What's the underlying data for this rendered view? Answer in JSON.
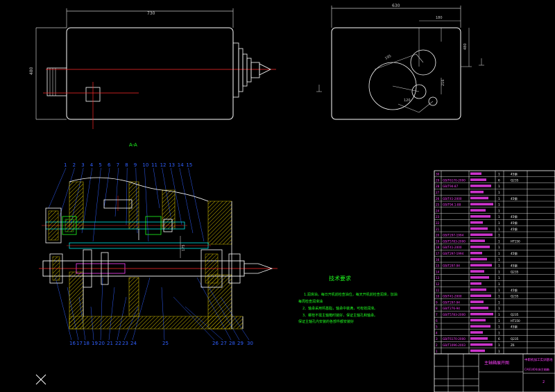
{
  "drawing": {
    "top_view_dim": "730",
    "top_view_height_dim": "480",
    "side_view_dim": "630",
    "side_view_dims": [
      "180",
      "480",
      "195",
      "216",
      "120"
    ],
    "section_label": "A-A",
    "part_numbers_top": [
      "1",
      "2",
      "3",
      "4",
      "5",
      "6",
      "7",
      "8",
      "9",
      "10",
      "11",
      "12",
      "13",
      "14",
      "15"
    ],
    "part_numbers_bottom": [
      "16",
      "17",
      "18",
      "19",
      "20",
      "21",
      "22",
      "23",
      "24",
      "25",
      "26",
      "27",
      "28",
      "29",
      "30"
    ],
    "inner_dims": [
      "175"
    ]
  },
  "tech_requirements": {
    "title": "技术要求",
    "lines": [
      "1.润滑油，每日开机前检查油位，每天开机前检查润滑，加油",
      "每周检查润滑油",
      "2、轴承采用钙基脂，轴承中装满，可有效润滑。",
      "3、螺栓不需主轴箱时装好，保证主轴孔和轴承。",
      "保证主轴孔内安装的各部件都安装好"
    ]
  },
  "bom": {
    "rows": [
      {
        "no": "30",
        "code": "",
        "name": "",
        "qty": "1",
        "mat": "45钢"
      },
      {
        "no": "29",
        "code": "GB/T6170-2000",
        "name": "",
        "qty": "6",
        "mat": "Q235"
      },
      {
        "no": "28",
        "code": "GB/T94-87",
        "name": "",
        "qty": "1",
        "mat": ""
      },
      {
        "no": "27",
        "code": "",
        "name": "",
        "qty": "1",
        "mat": ""
      },
      {
        "no": "26",
        "code": "GB/T41-2000",
        "name": "",
        "qty": "1",
        "mat": "45钢"
      },
      {
        "no": "25",
        "code": "GB/T94.1-88",
        "name": "",
        "qty": "1",
        "mat": ""
      },
      {
        "no": "24",
        "code": "",
        "name": "",
        "qty": "1",
        "mat": ""
      },
      {
        "no": "23",
        "code": "",
        "name": "",
        "qty": "1",
        "mat": "45钢"
      },
      {
        "no": "22",
        "code": "",
        "name": "",
        "qty": "1",
        "mat": "45钢"
      },
      {
        "no": "21",
        "code": "",
        "name": "",
        "qty": "1",
        "mat": "45钢"
      },
      {
        "no": "20",
        "code": "GB/T297-1994",
        "name": "",
        "qty": "1",
        "mat": ""
      },
      {
        "no": "19",
        "code": "GB/T5783-2000",
        "name": "",
        "qty": "1",
        "mat": "HT150"
      },
      {
        "no": "18",
        "code": "GB/T41-2000",
        "name": "",
        "qty": "1",
        "mat": ""
      },
      {
        "no": "17",
        "code": "GB/T297-1994",
        "name": "",
        "qty": "1",
        "mat": "45钢"
      },
      {
        "no": "16",
        "code": "",
        "name": "",
        "qty": "1",
        "mat": ""
      },
      {
        "no": "15",
        "code": "GB/T297-94",
        "name": "",
        "qty": "1",
        "mat": "45钢"
      },
      {
        "no": "14",
        "code": "",
        "name": "",
        "qty": "1",
        "mat": "Q235"
      },
      {
        "no": "13",
        "code": "",
        "name": "",
        "qty": "1",
        "mat": ""
      },
      {
        "no": "12",
        "code": "",
        "name": "",
        "qty": "1",
        "mat": ""
      },
      {
        "no": "11",
        "code": "",
        "name": "",
        "qty": "1",
        "mat": "45钢"
      },
      {
        "no": "10",
        "code": "GB/T41-2000",
        "name": "",
        "qty": "1",
        "mat": "Q235"
      },
      {
        "no": "9",
        "code": "GB/T297-94",
        "name": "",
        "qty": "1",
        "mat": ""
      },
      {
        "no": "8",
        "code": "GB/T276-94",
        "name": "",
        "qty": "1",
        "mat": ""
      },
      {
        "no": "7",
        "code": "GB/T5783-2000",
        "name": "",
        "qty": "1",
        "mat": "Q235"
      },
      {
        "no": "6",
        "code": "",
        "name": "",
        "qty": "1",
        "mat": "HT150"
      },
      {
        "no": "5",
        "code": "",
        "name": "",
        "qty": "1",
        "mat": "45钢"
      },
      {
        "no": "4",
        "code": "",
        "name": "",
        "qty": "1",
        "mat": ""
      },
      {
        "no": "3",
        "code": "GB/T6170-2000",
        "name": "",
        "qty": "6",
        "mat": "Q235"
      },
      {
        "no": "2",
        "code": "GB/T1096-2003",
        "name": "",
        "qty": "1",
        "mat": "Z6"
      },
      {
        "no": "1",
        "code": "",
        "name": "",
        "qty": "1",
        "mat": ""
      }
    ],
    "title_block": {
      "drawing_name": "主轴箱展开图",
      "company": "中职机加工实训基地",
      "drawing_no": "CA6140车床主轴箱",
      "sheet": "2"
    }
  },
  "colors": {
    "outline": "#ffffff",
    "center_line": "#ff2a2a",
    "hatch": "#c8b400",
    "shaft": "#00e5e5",
    "text_green": "#20ff20",
    "bom_text": "#ff40ff",
    "dim": "#c8c8c8",
    "blue": "#3060ff"
  }
}
